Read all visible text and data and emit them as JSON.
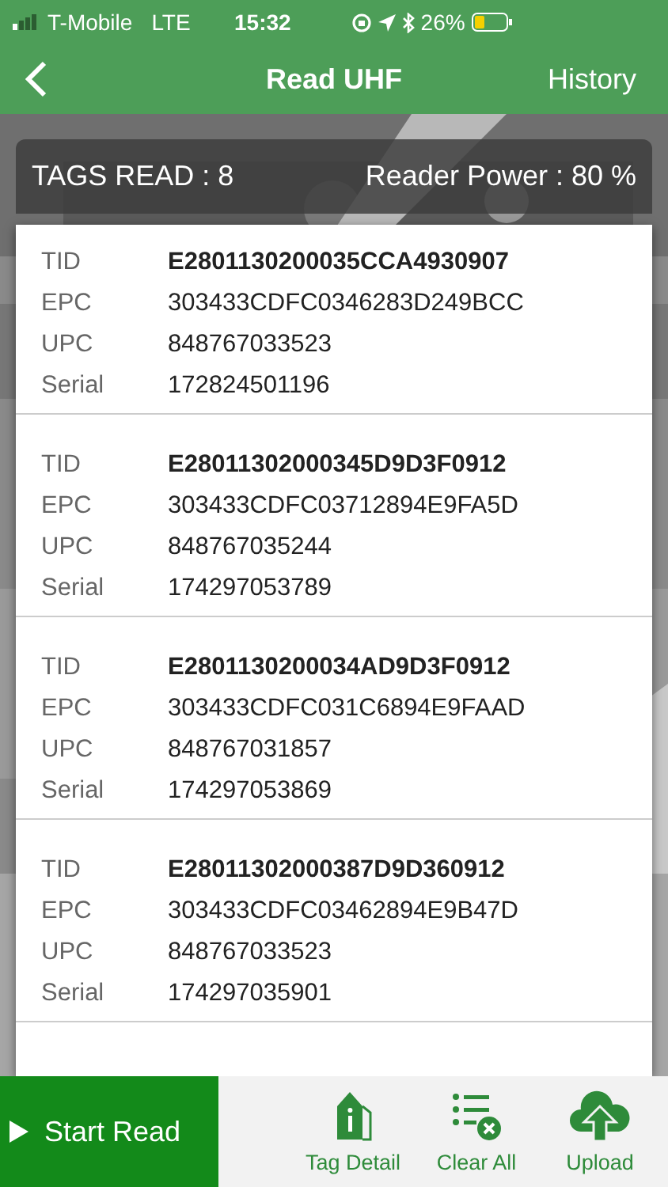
{
  "status_bar": {
    "carrier": "T-Mobile",
    "network": "LTE",
    "time": "15:32",
    "battery": "26%"
  },
  "nav": {
    "title": "Read UHF",
    "action": "History"
  },
  "summary": {
    "tags_read": "TAGS READ : 8",
    "reader_power": "Reader Power : 80 %"
  },
  "tags": [
    {
      "fields": [
        {
          "label": "TID",
          "value": "E2801130200035CCA4930907",
          "kind": "id"
        },
        {
          "label": "EPC",
          "value": "303433CDFC0346283D249BCC",
          "kind": "plain"
        },
        {
          "label": "UPC",
          "value": "848767033523",
          "kind": "plain"
        },
        {
          "label": "Serial",
          "value": "172824501196",
          "kind": "plain"
        }
      ]
    },
    {
      "fields": [
        {
          "label": "TID",
          "value": "E28011302000345D9D3F0912",
          "kind": "id"
        },
        {
          "label": "EPC",
          "value": "303433CDFC03712894E9FA5D",
          "kind": "plain"
        },
        {
          "label": "UPC",
          "value": "848767035244",
          "kind": "plain"
        },
        {
          "label": "Serial",
          "value": "174297053789",
          "kind": "plain"
        }
      ]
    },
    {
      "fields": [
        {
          "label": "TID",
          "value": "E2801130200034AD9D3F0912",
          "kind": "id"
        },
        {
          "label": "EPC",
          "value": "303433CDFC031C6894E9FAAD",
          "kind": "plain"
        },
        {
          "label": "UPC",
          "value": "848767031857",
          "kind": "plain"
        },
        {
          "label": "Serial",
          "value": "174297053869",
          "kind": "plain"
        }
      ]
    },
    {
      "fields": [
        {
          "label": "TID",
          "value": "E28011302000387D9D360912",
          "kind": "id"
        },
        {
          "label": "EPC",
          "value": "303433CDFC03462894E9B47D",
          "kind": "plain"
        },
        {
          "label": "UPC",
          "value": "848767033523",
          "kind": "plain"
        },
        {
          "label": "Serial",
          "value": "174297035901",
          "kind": "plain"
        }
      ]
    }
  ],
  "bottom_bar": {
    "start": "Start Read",
    "actions": [
      {
        "label": "Tag Detail",
        "kind": "tag"
      },
      {
        "label": "Clear All",
        "kind": "clear"
      },
      {
        "label": "Upload",
        "kind": "upload"
      }
    ]
  }
}
